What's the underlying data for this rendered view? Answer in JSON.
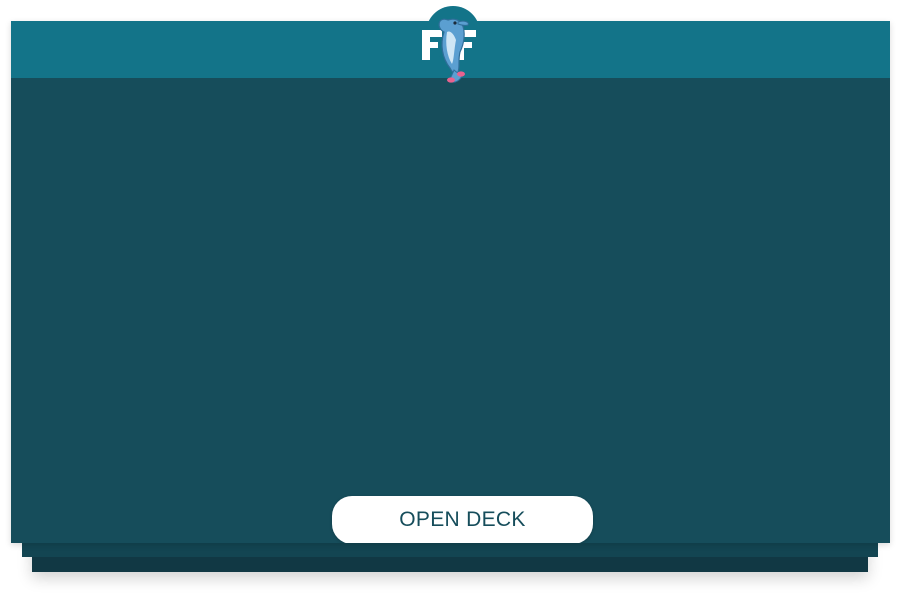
{
  "deck": {
    "open_button_label": "OPEN DECK"
  },
  "logo": {
    "icon": "dolphin-logo-icon",
    "letters": "FF"
  },
  "colors": {
    "header": "#137489",
    "card_body": "#164d5b",
    "stack_layer_2": "#134552",
    "stack_layer_3": "#113844",
    "button_bg": "#ffffff",
    "button_text": "#164d5b"
  }
}
